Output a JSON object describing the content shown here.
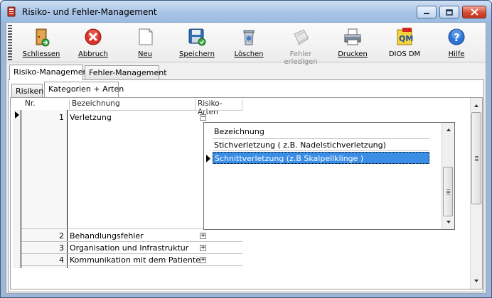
{
  "window": {
    "title": "Risiko- und Fehler-Management"
  },
  "toolbar": {
    "buttons": [
      {
        "label": "Schliessen",
        "icon": "door-exit-icon"
      },
      {
        "label": "Abbruch",
        "icon": "cancel-icon"
      },
      {
        "label": "Neu",
        "icon": "new-document-icon"
      },
      {
        "label": "Speichern",
        "icon": "save-disk-icon"
      },
      {
        "label": "Löschen",
        "icon": "trash-bin-icon"
      },
      {
        "label": "Fehler erledigen",
        "icon": "error-done-icon",
        "disabled": true
      },
      {
        "label": "Drucken",
        "icon": "printer-icon"
      },
      {
        "label": "DIOS DM",
        "icon": "qm-document-icon"
      },
      {
        "label": "Hilfe",
        "icon": "help-icon"
      }
    ]
  },
  "main_tabs": [
    {
      "label": "Risiko-Management",
      "active": true
    },
    {
      "label": "Fehler-Management",
      "active": false
    }
  ],
  "sub_tabs": [
    {
      "label": "Risiken",
      "active": false
    },
    {
      "label": "Kategorien + Arten",
      "active": true
    }
  ],
  "grid": {
    "headers": {
      "nr": "Nr.",
      "bezeichnung": "Bezeichnung",
      "risiko_arten": "Risiko-Arten"
    },
    "rows": [
      {
        "nr": "1",
        "bezeichnung": "Verletzung",
        "expanded": true
      },
      {
        "nr": "2",
        "bezeichnung": "Behandlungsfehler",
        "expanded": false
      },
      {
        "nr": "3",
        "bezeichnung": "Organisation und Infrastruktur",
        "expanded": false
      },
      {
        "nr": "4",
        "bezeichnung": "Kommunikation mit dem Patienten",
        "expanded": false
      }
    ],
    "subgrid": {
      "header": "Bezeichnung",
      "rows": [
        {
          "bezeichnung": "Stichverletzung ( z.B. Nadelstichverletzung)",
          "selected": false
        },
        {
          "bezeichnung": "Schnittverletzung (z.B Skalpellklinge )",
          "selected": true
        }
      ]
    }
  },
  "colors": {
    "selection": "#3a8ee6",
    "titlebar": "#a9c4e6",
    "close_button": "#d2452d"
  }
}
